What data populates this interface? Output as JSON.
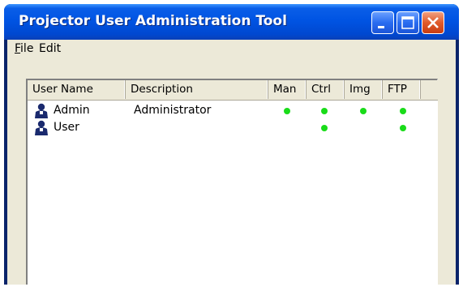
{
  "window": {
    "title": "Projector User Administration Tool",
    "controls": [
      "minimize-icon",
      "maximize-icon",
      "close-icon"
    ]
  },
  "menu": {
    "file": {
      "mnemonic": "F",
      "rest": "ile"
    },
    "edit": {
      "label": "Edit"
    }
  },
  "listview": {
    "columns": [
      "User Name",
      "Description",
      "Man",
      "Ctrl",
      "Img",
      "FTP"
    ],
    "rows": [
      {
        "name": "Admin",
        "description": "Administrator",
        "man": true,
        "ctrl": true,
        "img": true,
        "ftp": true
      },
      {
        "name": "User",
        "description": "",
        "man": false,
        "ctrl": true,
        "img": false,
        "ftp": true
      }
    ]
  },
  "colors": {
    "titlebar": "#0054e3",
    "status_dot": "#19dc19",
    "user_icon": "#1a2a6e"
  }
}
